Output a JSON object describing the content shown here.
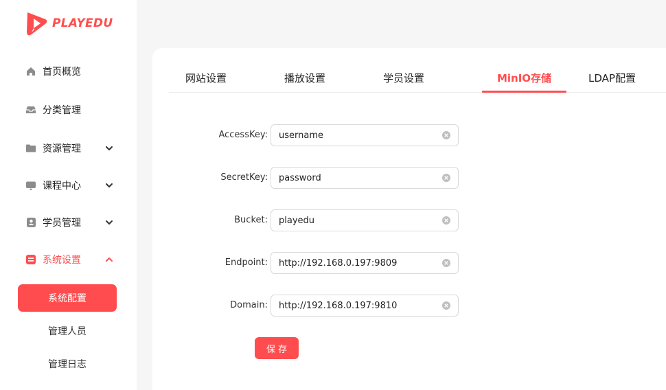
{
  "brand": {
    "name": "PLAYEDU",
    "color": "#ff4d4f"
  },
  "sidebar": {
    "items": [
      {
        "label": "首页概览",
        "icon": "home-icon",
        "expandable": false
      },
      {
        "label": "分类管理",
        "icon": "inbox-icon",
        "expandable": false
      },
      {
        "label": "资源管理",
        "icon": "folder-icon",
        "expandable": true,
        "expanded": false
      },
      {
        "label": "课程中心",
        "icon": "monitor-icon",
        "expandable": true,
        "expanded": false
      },
      {
        "label": "学员管理",
        "icon": "contact-card-icon",
        "expandable": true,
        "expanded": false
      },
      {
        "label": "系统设置",
        "icon": "settings-box-icon",
        "expandable": true,
        "expanded": true,
        "active": true
      }
    ],
    "sub_items": [
      {
        "label": "系统配置",
        "selected": true
      },
      {
        "label": "管理人员",
        "selected": false
      },
      {
        "label": "管理日志",
        "selected": false
      }
    ]
  },
  "tabs": [
    {
      "label": "网站设置",
      "active": false
    },
    {
      "label": "播放设置",
      "active": false
    },
    {
      "label": "学员设置",
      "active": false
    },
    {
      "label": "MinIO存储",
      "active": true
    },
    {
      "label": "LDAP配置",
      "active": false
    }
  ],
  "form": {
    "fields": [
      {
        "label": "AccessKey",
        "value": "username"
      },
      {
        "label": "SecretKey",
        "value": "password"
      },
      {
        "label": "Bucket",
        "value": "playedu"
      },
      {
        "label": "Endpoint",
        "value": "http://192.168.0.197:9809"
      },
      {
        "label": "Domain",
        "value": "http://192.168.0.197:9810"
      }
    ],
    "label_suffix": ":",
    "save_label": "保存"
  }
}
